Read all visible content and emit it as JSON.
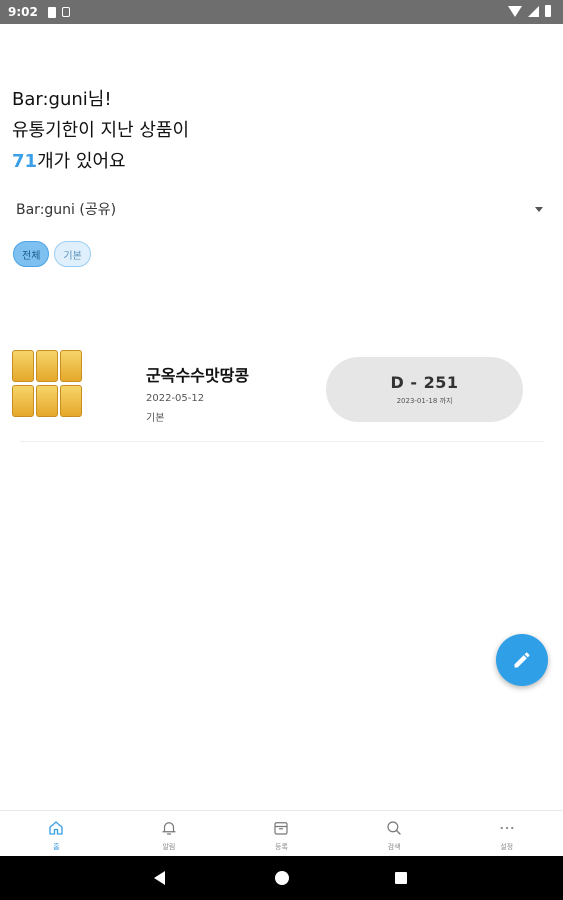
{
  "status_bar": {
    "time": "9:02"
  },
  "greeting": {
    "user": "Bar:guni",
    "honorific": "님!",
    "line2": "유통기한이 지난 상품이",
    "count": "71",
    "line3_suffix": "개가 있어요"
  },
  "group_select": {
    "value": "Bar:guni (공유)"
  },
  "chips": [
    {
      "label": "전체",
      "active": true
    },
    {
      "label": "기본",
      "active": false
    }
  ],
  "product": {
    "name": "군옥수수맛땅콩",
    "date": "2022-05-12",
    "category": "기본",
    "dday": "D - 251",
    "until": "2023-01-18 까지"
  },
  "fab": {
    "icon": "pencil-icon"
  },
  "bottom_nav": [
    {
      "label": "홈",
      "icon": "home-icon",
      "active": true
    },
    {
      "label": "알림",
      "icon": "bell-icon",
      "active": false
    },
    {
      "label": "등록",
      "icon": "box-icon",
      "active": false
    },
    {
      "label": "검색",
      "icon": "search-icon",
      "active": false
    },
    {
      "label": "설정",
      "icon": "more-icon",
      "active": false
    }
  ],
  "colors": {
    "accent": "#3b9fe8",
    "fab": "#2f9fe7",
    "chip_active": "#7ec0f0"
  }
}
